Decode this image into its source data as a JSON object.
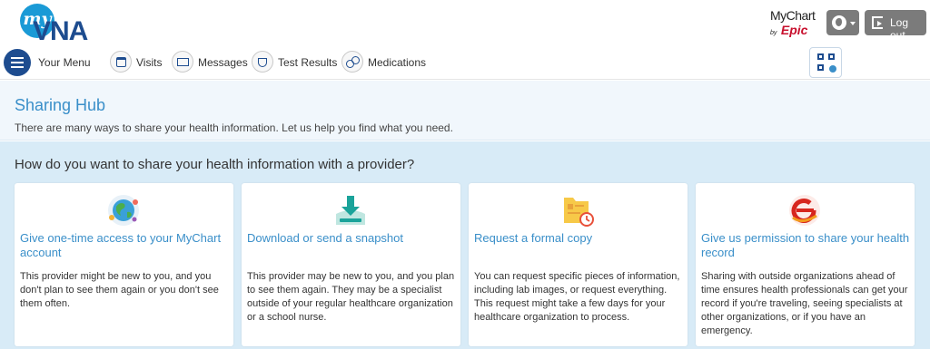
{
  "header": {
    "logo_my": "my",
    "logo_vna": "VNA",
    "mychart_text": "MyChart",
    "mychart_by": "by",
    "mychart_epic": "Epic",
    "logout_label": "Log out"
  },
  "nav": {
    "menu_label": "Your Menu",
    "items": [
      {
        "label": "Visits",
        "icon": "calendar-icon"
      },
      {
        "label": "Messages",
        "icon": "envelope-icon"
      },
      {
        "label": "Test Results",
        "icon": "flask-icon"
      },
      {
        "label": "Medications",
        "icon": "pills-icon"
      }
    ]
  },
  "hub": {
    "title": "Sharing Hub",
    "subtitle": "There are many ways to share your health information. Let us help you find what you need."
  },
  "main": {
    "question": "How do you want to share your health information with a provider?",
    "cards": [
      {
        "icon": "globe-icon",
        "title": "Give one-time access to your MyChart account",
        "body": "This provider might be new to you, and you don't plan to see them again or you don't see them often."
      },
      {
        "icon": "download-icon",
        "title": "Download or send a snapshot",
        "body": "This provider may be new to you, and you plan to see them again. They may be a specialist outside of your regular healthcare organization or a school nurse."
      },
      {
        "icon": "folder-clock-icon",
        "title": "Request a formal copy",
        "body": "You can request specific pieces of information, including lab images, or request everything. This request might take a few days for your healthcare organization to process."
      },
      {
        "icon": "care-everywhere-icon",
        "title": "Give us permission to share your health record",
        "body": "Sharing with outside organizations ahead of time ensures health professionals can get your record if you're traveling, seeing specialists at other organizations, or if you have an emergency."
      }
    ]
  },
  "colors": {
    "brand_blue": "#1d4c8f",
    "link_blue": "#3a8fc9",
    "section_bg": "#d8ebf7",
    "epic_red": "#c8102e"
  }
}
